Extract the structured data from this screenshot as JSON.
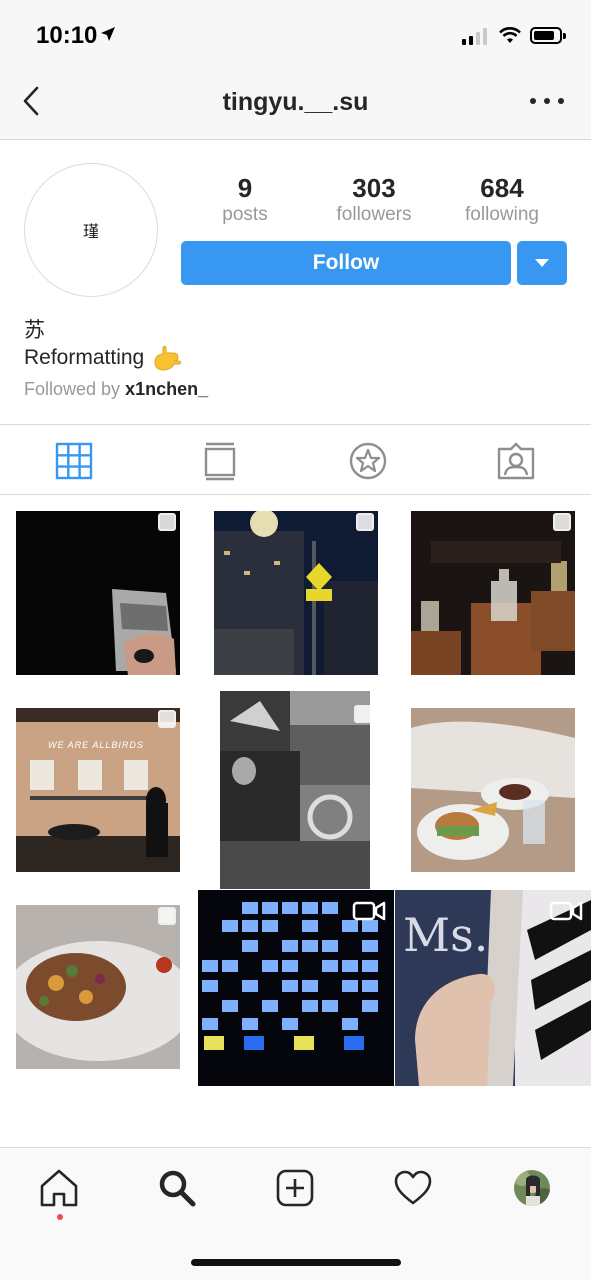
{
  "status_bar": {
    "time": "10:10"
  },
  "nav": {
    "title": "tingyu.__.su"
  },
  "profile": {
    "avatar_text": "瑾",
    "stats": [
      {
        "num": "9",
        "label": "posts"
      },
      {
        "num": "303",
        "label": "followers"
      },
      {
        "num": "684",
        "label": "following"
      }
    ],
    "follow_label": "Follow",
    "name": "苏",
    "bio": "Reformatting",
    "bio_emoji": "🤙",
    "followed_by_prefix": "Followed by ",
    "followed_by_user": "x1nchen_"
  },
  "tabs": [
    "grid-view",
    "feed-view",
    "saved-starred",
    "tagged-photos"
  ],
  "colors": {
    "accent": "#3897f0",
    "notification": "#ed4956",
    "text": "#262626",
    "muted": "#999999"
  },
  "posts": [
    {
      "name": "post-1-dark-photo",
      "type": "photo"
    },
    {
      "name": "post-2-street-night",
      "type": "photo"
    },
    {
      "name": "post-3-bottles",
      "type": "photo"
    },
    {
      "name": "post-4-allbirds-store",
      "type": "photo",
      "sign": "WE ARE ALLBIRDS"
    },
    {
      "name": "post-5-collage",
      "type": "photo"
    },
    {
      "name": "post-6-dinner",
      "type": "photo"
    },
    {
      "name": "post-7-salad",
      "type": "photo"
    },
    {
      "name": "post-8-tv-wall",
      "type": "video"
    },
    {
      "name": "post-9-magazine",
      "type": "video",
      "cover_text": "Ms."
    }
  ]
}
